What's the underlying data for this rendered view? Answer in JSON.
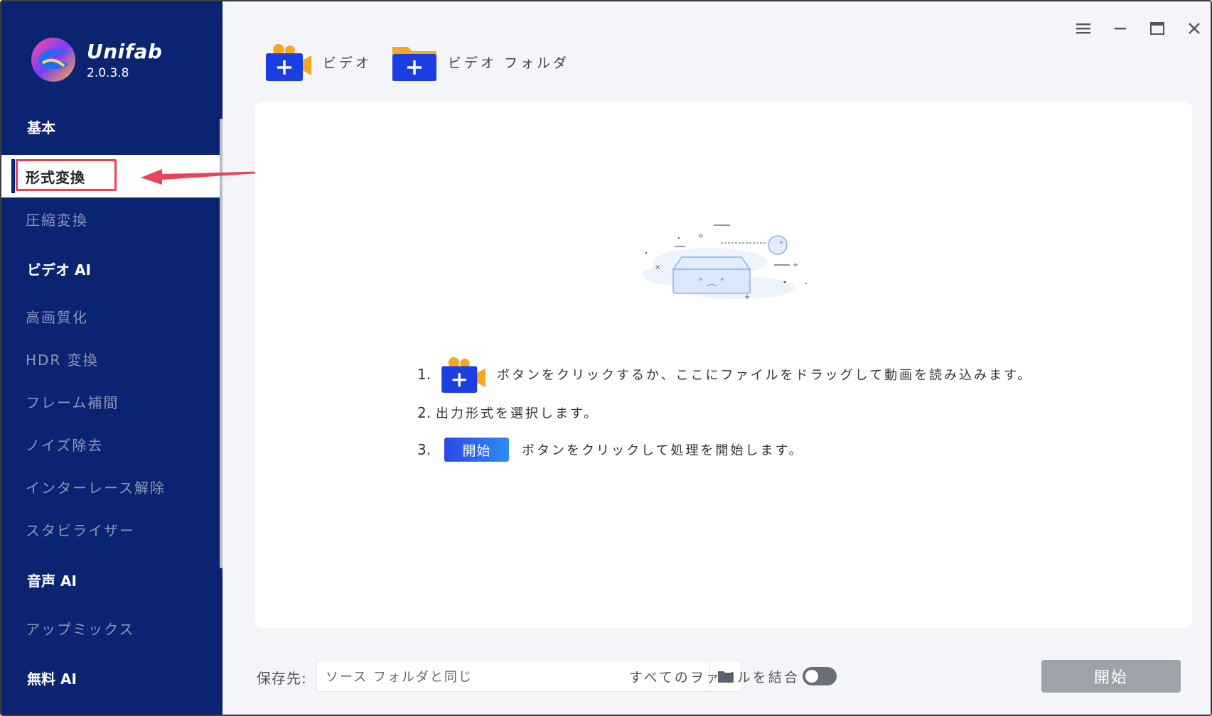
{
  "app": {
    "name": "Unifab",
    "version": "2.0.3.8"
  },
  "sidebar": {
    "groups": [
      {
        "label": "基本",
        "items": [
          {
            "label": "形式変換",
            "active": true
          },
          {
            "label": "圧縮変換"
          }
        ]
      },
      {
        "label": "ビデオ AI",
        "items": [
          {
            "label": "高画質化"
          },
          {
            "label": "HDR 変換"
          },
          {
            "label": "フレーム補間"
          },
          {
            "label": "ノイズ除去"
          },
          {
            "label": "インターレース解除"
          },
          {
            "label": "スタビライザー"
          }
        ]
      },
      {
        "label": "音声 AI",
        "items": [
          {
            "label": "アップミックス"
          }
        ]
      },
      {
        "label": "無料 AI",
        "items": []
      }
    ]
  },
  "toolbar": {
    "add_video_label": "ビデオ",
    "add_folder_label": "ビデオ フォルダ"
  },
  "window_controls": {
    "menu": "menu-icon",
    "minimize": "minimize-icon",
    "maximize": "maximize-icon",
    "close": "close-icon"
  },
  "instructions": {
    "step1": {
      "num": "1.",
      "text": "ボタンをクリックするか、ここにファイルをドラッグして動画を読み込みます。"
    },
    "step2": {
      "num": "2.",
      "text": "出力形式を選択します。"
    },
    "step3": {
      "num": "3.",
      "button": "開始",
      "text": "ボタンをクリックして処理を開始します。"
    }
  },
  "bottom": {
    "save_label": "保存先:",
    "save_value": "ソース フォルダと同じ",
    "merge_label": "すべてのヲァイルを結合",
    "merge_enabled": false,
    "start_label": "開始"
  },
  "colors": {
    "sidebar_bg": "#0a2472",
    "accent": "#2b48e8",
    "annotation": "#e8435a"
  }
}
